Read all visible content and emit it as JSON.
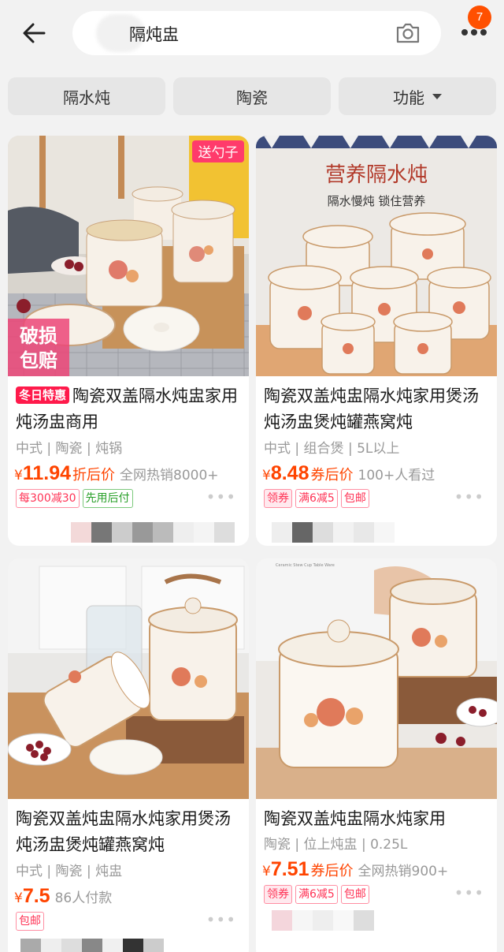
{
  "header": {
    "search_text": "隔炖盅",
    "cart_badge": "7",
    "icons": [
      "back-arrow-icon",
      "camera-icon",
      "more-icon"
    ]
  },
  "filters": [
    {
      "label": "隔水炖"
    },
    {
      "label": "陶瓷"
    },
    {
      "label": "功能"
    }
  ],
  "products": [
    {
      "badge": "送勺子",
      "overlay": "破损\n包赔",
      "hot_tag": "冬日特惠",
      "title": "陶瓷双盖隔水炖盅家用炖汤盅商用",
      "attrs": "中式 | 陶瓷 | 炖锅",
      "currency": "¥",
      "price": "11.94",
      "price_label": "折后价",
      "stat": "全网热销8000+",
      "promos": [
        "每300减30",
        "先用后付"
      ]
    },
    {
      "banner_title": "营养隔水炖",
      "banner_sub": "隔水慢炖 锁住营养",
      "title": "陶瓷双盖炖盅隔水炖家用煲汤炖汤盅煲炖罐燕窝炖",
      "attrs": "中式 | 组合煲 | 5L以上",
      "currency": "¥",
      "price": "8.48",
      "price_label": "券后价",
      "stat": "100+人看过",
      "promos": [
        "领券",
        "满6减5",
        "包邮"
      ]
    },
    {
      "title": "陶瓷双盖炖盅隔水炖家用煲汤炖汤盅煲炖罐燕窝炖",
      "attrs": "中式 | 陶瓷 | 炖盅",
      "currency": "¥",
      "price": "7.5",
      "stat": "86人付款",
      "promos": [
        "包邮"
      ]
    },
    {
      "title": "陶瓷双盖炖盅隔水炖家用",
      "attrs": "陶瓷 | 位上炖盅 | 0.25L",
      "currency": "¥",
      "price": "7.51",
      "price_label": "券后价",
      "stat": "全网热销900+",
      "promos": [
        "领券",
        "满6减5",
        "包邮"
      ]
    }
  ],
  "colors": {
    "accent": "#ff4400",
    "badge": "#ff5000",
    "hot": "#ff1a4b",
    "background": "#f2f2f2"
  }
}
